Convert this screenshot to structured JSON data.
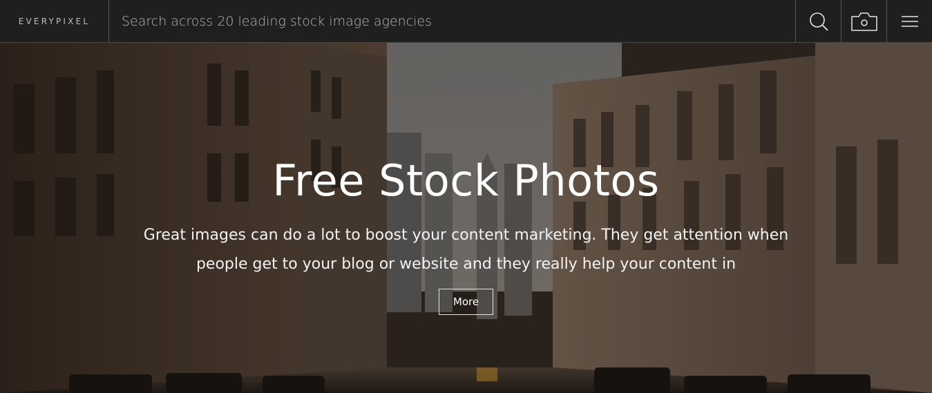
{
  "header": {
    "logo_text": "EVERYPIXEL",
    "search_placeholder": "Search across 20 leading stock image agencies",
    "icons": [
      "search-icon",
      "camera-icon",
      "menu-icon"
    ]
  },
  "hero": {
    "title": "Free Stock Photos",
    "text": "Great images can do a lot to boost your content marketing. They get attention when people get to your blog or website and they really help your content in",
    "more_label": "More"
  },
  "colors": {
    "topbar_bg": "#1f1f1f",
    "divider": "#555555",
    "hero_text": "#ffffff"
  }
}
